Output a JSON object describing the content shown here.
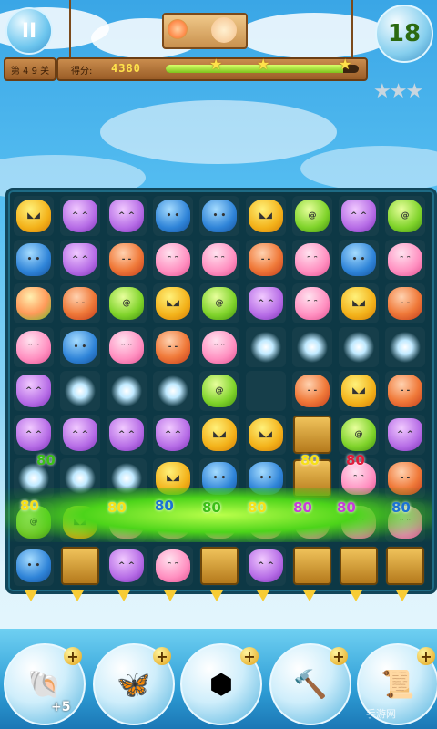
{
  "hud": {
    "level_label": "第 4 9 关",
    "score_label": "得分:",
    "score_value": "4380",
    "moves_left": "18",
    "pause_glyph": "II",
    "progress_fraction": 0.92
  },
  "board": {
    "cols": 9,
    "rows": 9,
    "grid": [
      [
        "yellow",
        "purple",
        "purple",
        "blue",
        "blue",
        "yellow",
        "green",
        "purple",
        "green"
      ],
      [
        "blue",
        "purple",
        "red",
        "pink",
        "pink",
        "red",
        "pink",
        "blue",
        "pink"
      ],
      [
        "peach",
        "red",
        "green",
        "yellow",
        "green",
        "purple",
        "pink",
        "yellow",
        "red"
      ],
      [
        "pink",
        "blue",
        "pink",
        "red",
        "pink",
        "spark",
        "spark",
        "spark",
        "spark"
      ],
      [
        "purple",
        "spark",
        "spark",
        "spark",
        "green",
        "empty",
        "red",
        "yellow",
        "red"
      ],
      [
        "purple",
        "purple",
        "purple",
        "purple",
        "yellow",
        "yellow",
        "crate",
        "green",
        "purple"
      ],
      [
        "spark",
        "spark",
        "spark",
        "yellow",
        "blue",
        "blue",
        "crate",
        "pink",
        "red"
      ],
      [
        "green",
        "yellow",
        "pink",
        "pink",
        "pink",
        "pink",
        "pink",
        "pink",
        "pink"
      ],
      [
        "blue",
        "crate",
        "purple",
        "pink",
        "crate",
        "purple",
        "crate",
        "crate",
        "crate"
      ]
    ]
  },
  "floating_points": [
    "80",
    "80",
    "80",
    "80",
    "80",
    "80",
    "80",
    "80",
    "80",
    "80",
    "80"
  ],
  "floating_point_colors": [
    "b-yellow",
    "b-yellow",
    "b-blue",
    "b-green",
    "b-yellow",
    "b-purple",
    "b-purple",
    "b-blue",
    "b-red",
    "b-yellow",
    "b-green"
  ],
  "tools": [
    {
      "name": "shell-booster-icon",
      "glyph": "🐚",
      "label": "+5"
    },
    {
      "name": "wings-booster-icon",
      "glyph": "🦋",
      "label": ""
    },
    {
      "name": "gem-booster-icon",
      "glyph": "⬢",
      "label": ""
    },
    {
      "name": "hammer-booster-icon",
      "glyph": "🔨",
      "label": ""
    },
    {
      "name": "scroll-booster-icon",
      "glyph": "📜",
      "label": ""
    }
  ],
  "watermark": "手游网"
}
